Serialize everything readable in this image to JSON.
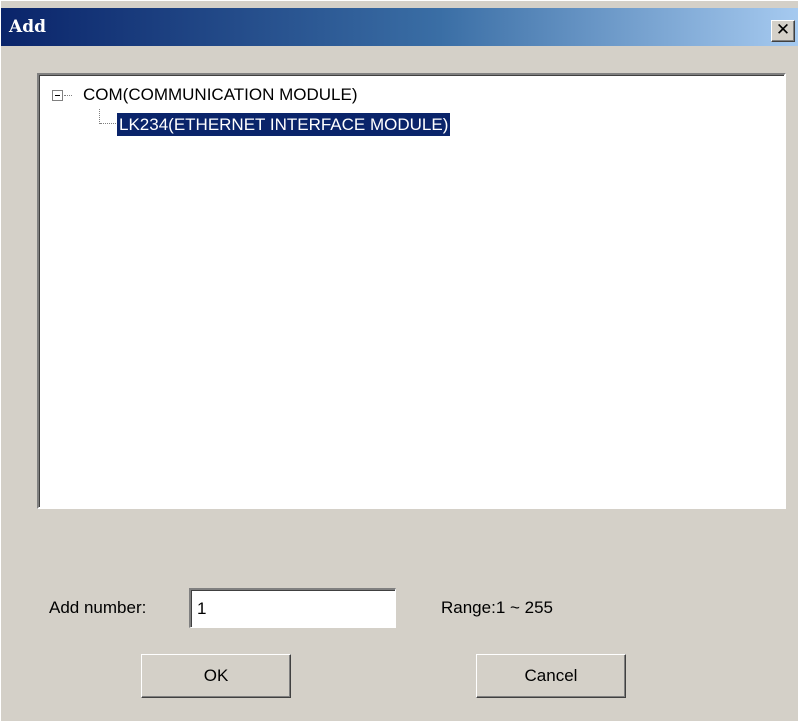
{
  "window": {
    "title": "Add",
    "close_glyph": "✕",
    "close_icon": "close-icon"
  },
  "tree": {
    "root": {
      "label": "COM(COMMUNICATION MODULE)",
      "expanded": true,
      "expander_icon": "minus-box-icon"
    },
    "children": [
      {
        "label": "LK234(ETHERNET INTERFACE MODULE)",
        "selected": true
      }
    ]
  },
  "form": {
    "add_number_label": "Add number:",
    "add_number_value": "1",
    "range_label": "Range:1 ~ 255"
  },
  "buttons": {
    "ok": "OK",
    "cancel": "Cancel"
  },
  "colors": {
    "face": "#d4d0c8",
    "selection": "#0a246a",
    "title_start": "#0a246a",
    "title_end": "#a6caf0"
  }
}
